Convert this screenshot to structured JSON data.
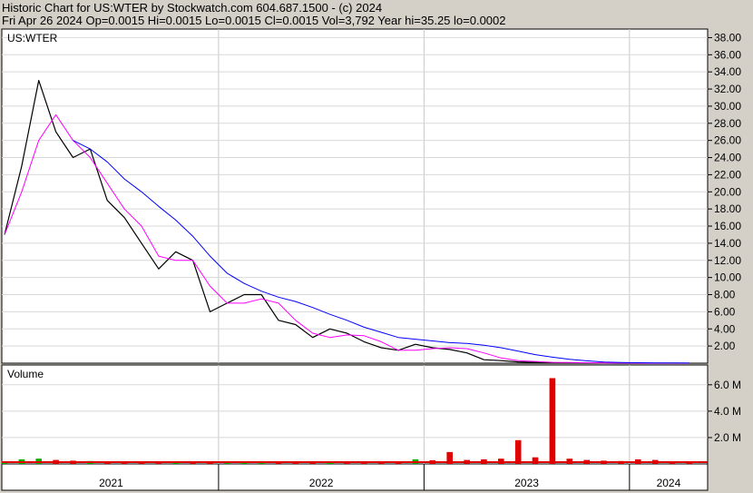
{
  "header": {
    "line1": "Historic Chart for US:WTER by Stockwatch.com 604.687.1500 - (c) 2024",
    "line2": "Fri Apr 26 2024   Op=0.0015   Hi=0.0015   Lo=0.0015   Cl=0.0015   Vol=3,792   Year hi=35.25   lo=0.0002"
  },
  "colors": {
    "background": "#d4d0c8",
    "panel": "#ffffff",
    "price": "#000000",
    "ma_short": "#ff00ff",
    "ma_long": "#0000ff",
    "vol_up": "#00b000",
    "vol_down": "#e00000"
  },
  "chart_data": [
    {
      "type": "line",
      "label": "US:WTER",
      "ylim": [
        0,
        39
      ],
      "yticks": [
        "2.00",
        "4.00",
        "6.00",
        "8.00",
        "10.00",
        "12.00",
        "14.00",
        "16.00",
        "18.00",
        "20.00",
        "22.00",
        "24.00",
        "26.00",
        "28.00",
        "30.00",
        "32.00",
        "34.00",
        "36.00",
        "38.00"
      ],
      "xlabels": [
        "2021",
        "2022",
        "2023",
        "2024"
      ],
      "x": [
        "2020-12",
        "2021-01",
        "2021-02",
        "2021-03",
        "2021-04",
        "2021-05",
        "2021-06",
        "2021-07",
        "2021-08",
        "2021-09",
        "2021-10",
        "2021-11",
        "2021-12",
        "2022-01",
        "2022-02",
        "2022-03",
        "2022-04",
        "2022-05",
        "2022-06",
        "2022-07",
        "2022-08",
        "2022-09",
        "2022-10",
        "2022-11",
        "2022-12",
        "2023-01",
        "2023-02",
        "2023-03",
        "2023-04",
        "2023-05",
        "2023-06",
        "2023-07",
        "2023-08",
        "2023-09",
        "2023-10",
        "2023-11",
        "2023-12",
        "2024-01",
        "2024-02",
        "2024-03",
        "2024-04"
      ],
      "series": [
        {
          "values": [
            15,
            23,
            33,
            27,
            24,
            25,
            19,
            17,
            14,
            11,
            13,
            12,
            6,
            7,
            8,
            8,
            5,
            4.5,
            3,
            4,
            3.5,
            2.5,
            1.8,
            1.5,
            2.2,
            1.8,
            1.6,
            1.2,
            0.4,
            0.3,
            0.15,
            0.1,
            0.05,
            0.03,
            0.02,
            0.01,
            0.005,
            0.004,
            0.003,
            0.002,
            0.0015
          ]
        },
        {
          "values": [
            15,
            20,
            26,
            29,
            26,
            24,
            21,
            18,
            16,
            12.5,
            12,
            12,
            9,
            7,
            7,
            7.5,
            7,
            5,
            3.5,
            3,
            3.3,
            3.2,
            2.5,
            1.5,
            1.5,
            1.7,
            1.8,
            1.7,
            1.2,
            0.6,
            0.3,
            0.2,
            0.1,
            0.07,
            0.05,
            0.03,
            0.02,
            0.01,
            0.005,
            0.003,
            0.002
          ]
        },
        {
          "values": [
            null,
            null,
            null,
            null,
            26,
            25,
            23.5,
            21.5,
            20,
            18.3,
            16.7,
            14.8,
            12.5,
            10.5,
            9.3,
            8.4,
            7.7,
            7.2,
            6.5,
            5.7,
            5.0,
            4.2,
            3.6,
            3.0,
            2.8,
            2.6,
            2.4,
            2.3,
            2.1,
            1.8,
            1.4,
            1.0,
            0.7,
            0.45,
            0.28,
            0.14,
            0.07,
            0.05,
            0.035,
            0.02,
            0.01
          ]
        }
      ]
    },
    {
      "type": "bar",
      "label": "Volume",
      "ylim": [
        0,
        7500000
      ],
      "yticks": [
        "2.0 M",
        "4.0 M",
        "6.0 M"
      ],
      "series": [
        {
          "values": [
            200000,
            350000,
            400000,
            300000,
            250000,
            220000,
            200000,
            180000,
            170000,
            150000,
            200000,
            180000,
            150000,
            120000,
            130000,
            140000,
            150000,
            130000,
            120000,
            110000,
            100000,
            120000,
            150000,
            200000,
            350000,
            280000,
            900000,
            300000,
            350000,
            400000,
            1800000,
            500000,
            6500000,
            400000,
            300000,
            250000,
            220000,
            350000,
            300000,
            200000,
            150000
          ]
        }
      ]
    }
  ]
}
